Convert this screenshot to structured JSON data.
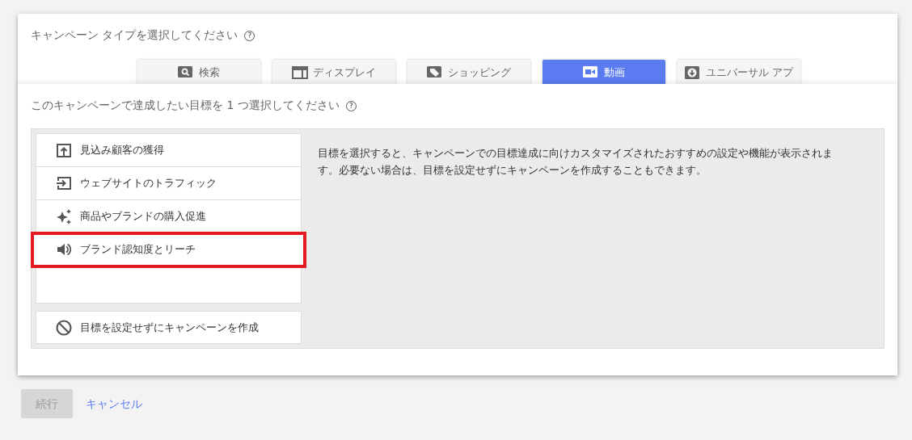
{
  "campaign_type": {
    "title": "キャンペーン タイプを選択してください",
    "help": "?"
  },
  "tabs": [
    {
      "label": "検索",
      "kind": "search",
      "selected": false
    },
    {
      "label": "ディスプレイ",
      "kind": "display",
      "selected": false
    },
    {
      "label": "ショッピング",
      "kind": "shopping",
      "selected": false
    },
    {
      "label": "動画",
      "kind": "video",
      "selected": true
    },
    {
      "label": "ユニバーサル アプ",
      "kind": "app",
      "selected": false
    }
  ],
  "goal": {
    "title": "このキャンペーンで達成したい目標を 1 つ選択してください",
    "help": "?"
  },
  "goals": [
    {
      "label": "見込み顧客の獲得",
      "kind": "leads",
      "highlighted": false
    },
    {
      "label": "ウェブサイトのトラフィック",
      "kind": "traffic",
      "highlighted": false
    },
    {
      "label": "商品やブランドの購入促進",
      "kind": "sparkle",
      "highlighted": false
    },
    {
      "label": "ブランド認知度とリーチ",
      "kind": "speaker",
      "highlighted": true
    }
  ],
  "no_goal": {
    "label": "目標を設定せずにキャンペーンを作成"
  },
  "description": "目標を選択すると、キャンペーンでの目標達成に向けカスタマイズされたおすすめの設定や機能が表示されます。必要ない場合は、目標を設定せずにキャンペーンを作成することもできます。",
  "buttons": {
    "continue": {
      "label": "続行",
      "disabled": true
    },
    "cancel": {
      "label": "キャンセル"
    }
  }
}
